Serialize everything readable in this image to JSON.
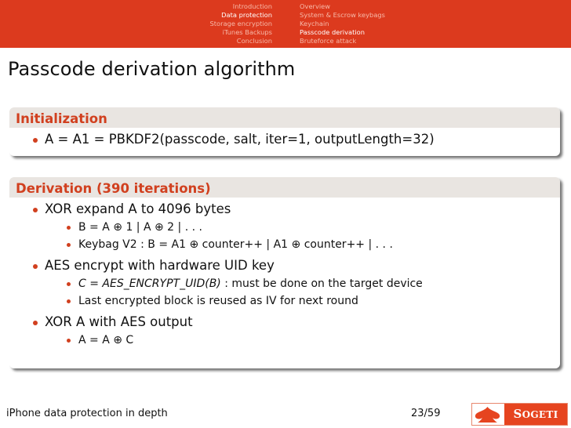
{
  "header": {
    "sections": [
      {
        "label": "Introduction",
        "active": false
      },
      {
        "label": "Data protection",
        "active": true
      },
      {
        "label": "Storage encryption",
        "active": false
      },
      {
        "label": "iTunes Backups",
        "active": false
      },
      {
        "label": "Conclusion",
        "active": false
      }
    ],
    "subsections": [
      {
        "label": "Overview",
        "active": false
      },
      {
        "label": "System & Escrow keybags",
        "active": false
      },
      {
        "label": "Keychain",
        "active": false
      },
      {
        "label": "Passcode derivation",
        "active": true
      },
      {
        "label": "Bruteforce attack",
        "active": false
      }
    ]
  },
  "slide": {
    "title": "Passcode derivation algorithm",
    "blocks": [
      {
        "title": "Initialization",
        "items": [
          {
            "text": "A = A1 = PBKDF2(passcode, salt, iter=1, outputLength=32)",
            "subitems": []
          }
        ]
      },
      {
        "title": "Derivation (390 iterations)",
        "items": [
          {
            "text": "XOR expand A to 4096 bytes",
            "subitems": [
              "B = A ⊕ 1 | A ⊕ 2 | . . .",
              "Keybag V2 : B = A1 ⊕ counter++ | A1 ⊕ counter++ | . . ."
            ]
          },
          {
            "text": "AES encrypt with hardware UID key",
            "subitems": [
              {
                "math": "C = AES_ENCRYPT_UID(B)",
                "text": " :  must be done on the target device"
              },
              "Last encrypted block is reused as IV for next round"
            ]
          },
          {
            "text": "XOR A with AES output",
            "subitems": [
              "A = A ⊕ C"
            ]
          }
        ]
      }
    ]
  },
  "footer": {
    "title": "iPhone data protection in depth",
    "page": "23/59",
    "logo_text_first": "S",
    "logo_text_rest": "OGETI"
  },
  "colors": {
    "accent": "#dc3a1e",
    "block_title": "#d1401f",
    "block_header_bg": "#e9e5e1"
  }
}
